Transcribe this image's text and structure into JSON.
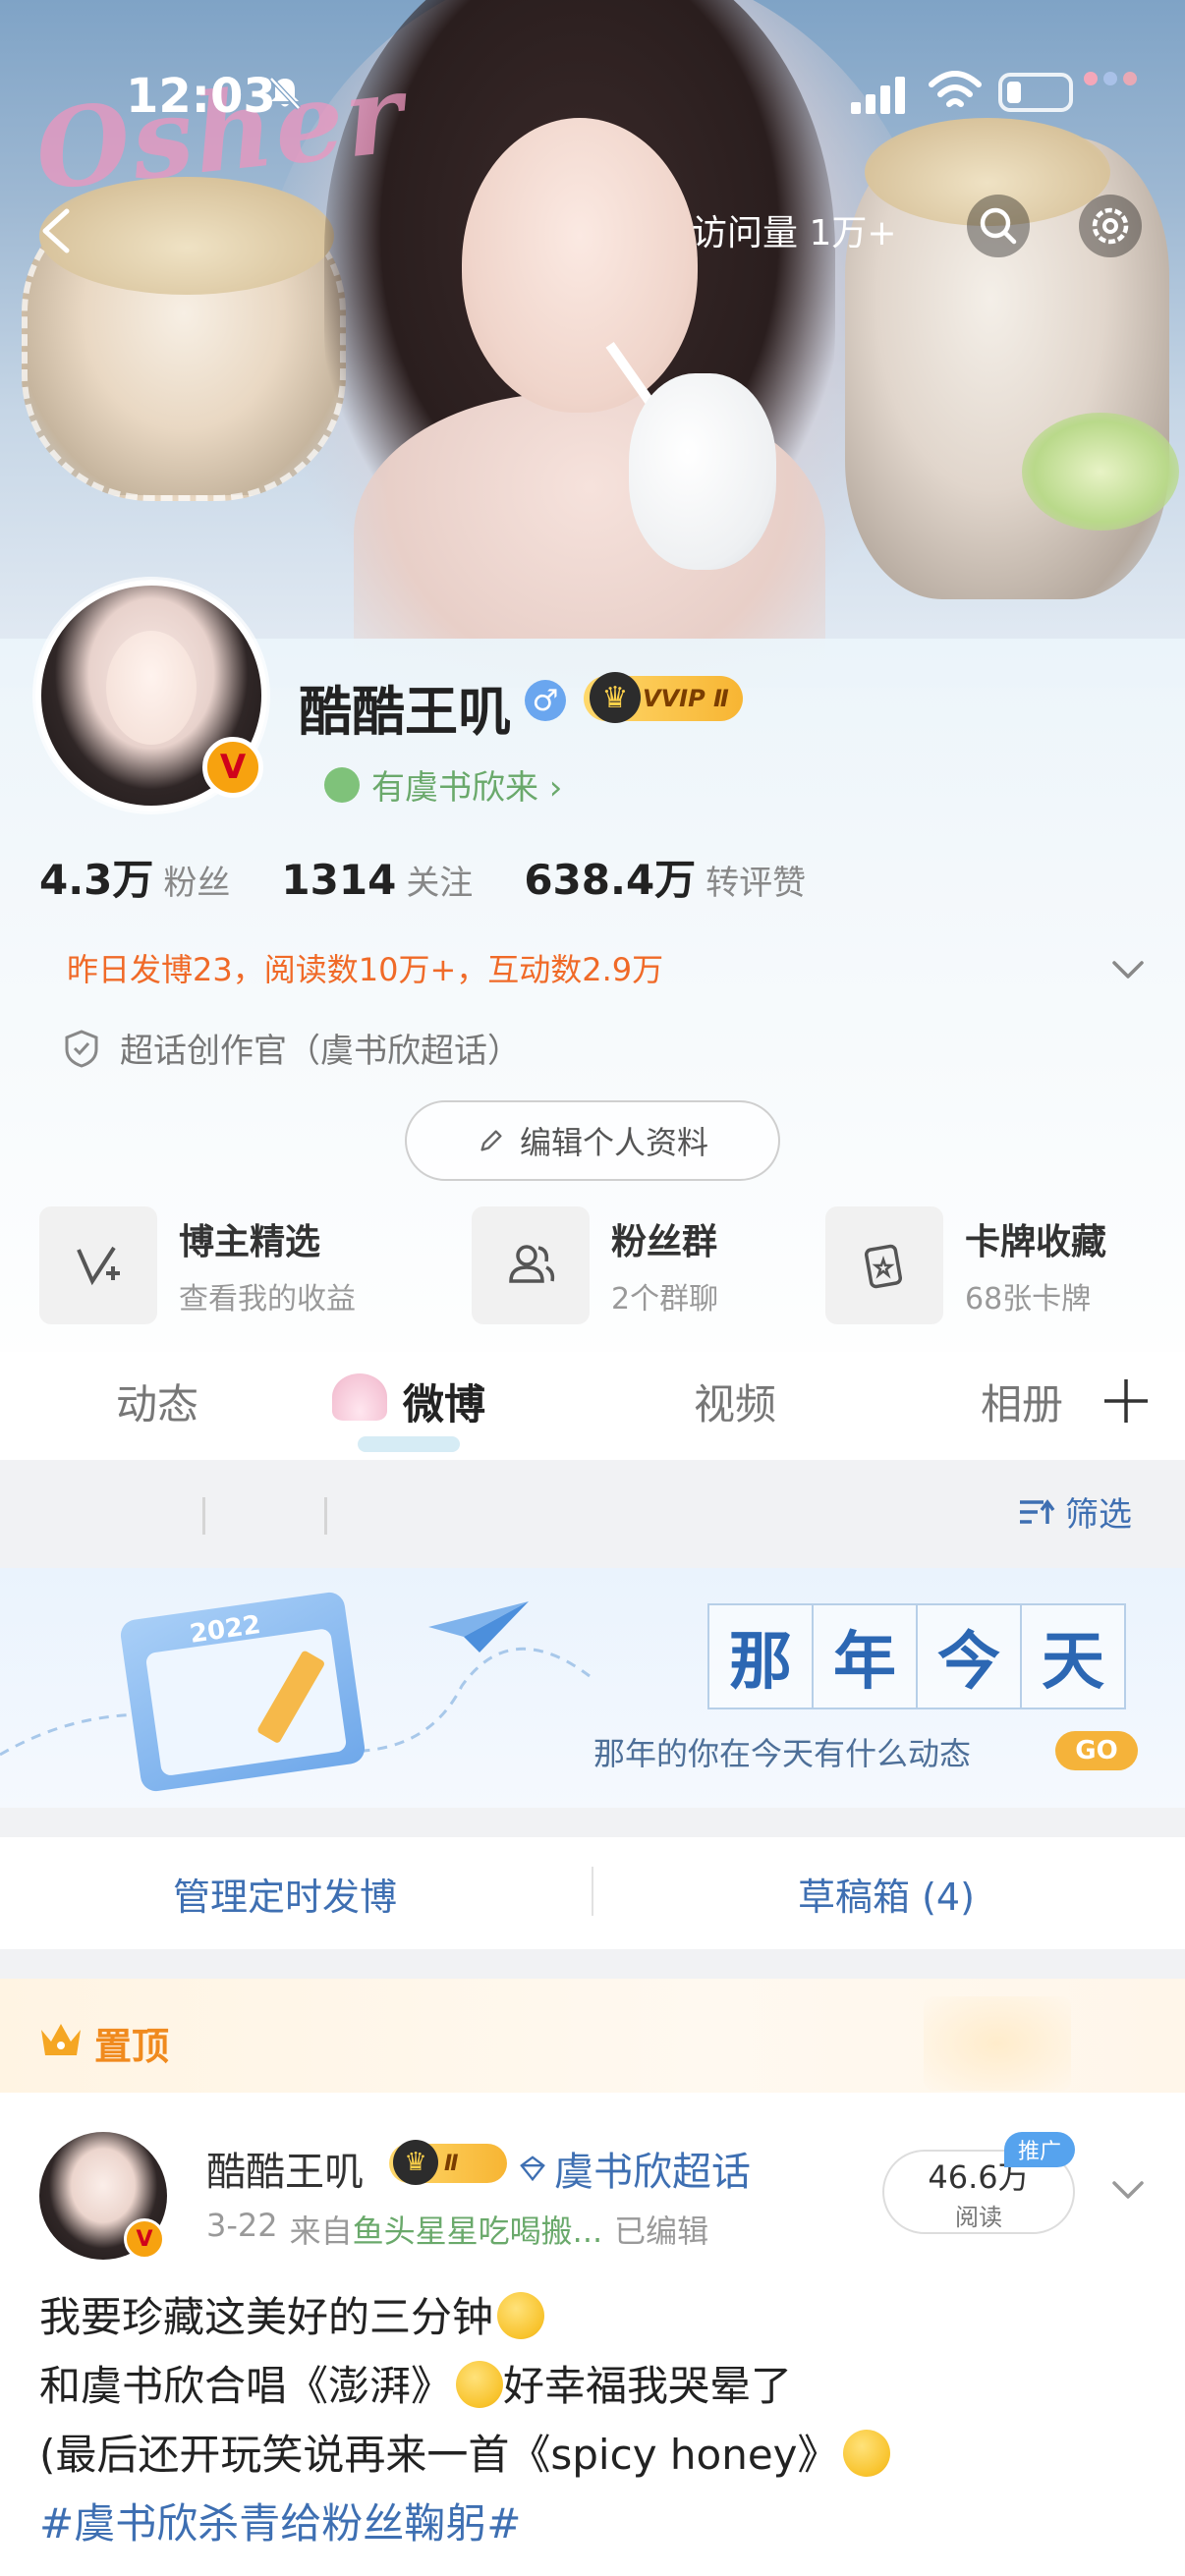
{
  "status_bar": {
    "time": "12:03"
  },
  "banner": {
    "logo_text": "Osher",
    "visit_count": "访问量 1万+"
  },
  "profile": {
    "name": "酷酷王叽",
    "vip_label": "VVIP Ⅱ",
    "verified_badge": "V",
    "gender_symbol": "♂",
    "friend_text": "有虞书欣来 ›",
    "stats": [
      {
        "value": "4.3万",
        "label": "粉丝"
      },
      {
        "value": "1314",
        "label": "关注"
      },
      {
        "value": "638.4万",
        "label": "转评赞"
      }
    ],
    "yesterday_summary": "昨日发博23，阅读数10万+，互动数2.9万",
    "super_topic_role": "超话创作官（虞书欣超话）",
    "edit_profile_label": "编辑个人资料",
    "shortcuts": [
      {
        "title": "博主精选",
        "subtitle": "查看我的收益",
        "icon": "v-plus-icon"
      },
      {
        "title": "粉丝群",
        "subtitle": "2个群聊",
        "icon": "group-icon"
      },
      {
        "title": "卡牌收藏",
        "subtitle": "68张卡牌",
        "icon": "card-icon"
      }
    ]
  },
  "tabs": [
    {
      "label": "动态",
      "active": false
    },
    {
      "label": "微博",
      "active": true
    },
    {
      "label": "视频",
      "active": false
    },
    {
      "label": "相册",
      "active": false
    }
  ],
  "filter": {
    "label": "筛选"
  },
  "memory_banner": {
    "title_chars": [
      "那",
      "年",
      "今",
      "天"
    ],
    "subtitle": "那年的你在今天有什么动态",
    "go_label": "GO",
    "calendar_year": "2022"
  },
  "actions": {
    "scheduled": "管理定时发博",
    "drafts": "草稿箱 (4)"
  },
  "pinned": {
    "label": "置顶"
  },
  "post": {
    "author": "酷酷王叽",
    "vip_label": "Ⅱ",
    "topic": "虞书欣超话",
    "date": "3-22",
    "source_prefix": "来自",
    "source": "鱼头星星吃喝搬...",
    "edited": "已编辑",
    "reads_value": "46.6万",
    "reads_label": "阅读",
    "promo_label": "推广",
    "lines": [
      "我要珍藏这美好的三分钟",
      "和虞书欣合唱《澎湃》",
      "好幸福我哭晕了",
      "(最后还开玩笑说再来一首《spicy honey》",
      "#虞书欣杀青给粉丝鞠躬#"
    ]
  }
}
